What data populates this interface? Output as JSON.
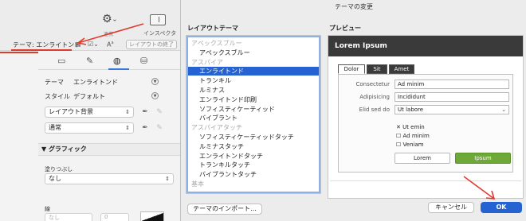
{
  "left_panel": {
    "toolbar": {
      "kanren_label": "連携",
      "inspector_label": "インスペクタ"
    },
    "theme_bar": {
      "theme_label": "テーマ: エンライトンド",
      "layout_button": "レイアウトの終了"
    },
    "properties": {
      "theme_label": "テーマ",
      "theme_value": "エンライトンド",
      "style_label": "スタイル",
      "style_value": "デフォルト",
      "layout_popup": "レイアウト背景",
      "normal_popup": "通常"
    },
    "graphics_section": {
      "header": "▼ グラフィック",
      "fill_label": "塗りつぶし",
      "fill_value": "なし",
      "line_label": "線",
      "line_value": "なし",
      "line_number": "0"
    }
  },
  "dialog": {
    "title": "テーマの変更",
    "layout_theme_heading": "レイアウトテーマ",
    "preview_heading": "プレビュー",
    "theme_list": [
      {
        "label": "アペックスブルー",
        "kind": "group"
      },
      {
        "label": "アペックスブルー",
        "kind": "theme"
      },
      {
        "label": "アスパイア",
        "kind": "group"
      },
      {
        "label": "エンライトンド",
        "kind": "theme",
        "selected": true
      },
      {
        "label": "トランキル",
        "kind": "theme"
      },
      {
        "label": "ルミナス",
        "kind": "theme"
      },
      {
        "label": "エンライトンド印刷",
        "kind": "theme"
      },
      {
        "label": "ソフィスティケーティッド",
        "kind": "theme"
      },
      {
        "label": "バイブラント",
        "kind": "theme"
      },
      {
        "label": "アスパイアタッチ",
        "kind": "group"
      },
      {
        "label": "ソフィスティケーティッドタッチ",
        "kind": "theme"
      },
      {
        "label": "ルミナスタッチ",
        "kind": "theme"
      },
      {
        "label": "エンライトンドタッチ",
        "kind": "theme"
      },
      {
        "label": "トランキルタッチ",
        "kind": "theme"
      },
      {
        "label": "バイブラントタッチ",
        "kind": "theme"
      },
      {
        "label": "基本",
        "kind": "group"
      }
    ],
    "import_button": "テーマのインポート...",
    "preview": {
      "title": "Lorem Ipsum",
      "tabs": [
        "Dolor",
        "Sit",
        "Amet"
      ],
      "fields": [
        {
          "label": "Consectetur",
          "value": "Ad minim"
        },
        {
          "label": "Adipisicing",
          "value": "Incididunt"
        },
        {
          "label": "Elid sed do",
          "value": "Ut labore"
        }
      ],
      "checks": [
        {
          "label": "Ut emin",
          "checked": true
        },
        {
          "label": "Ad minim",
          "checked": false
        },
        {
          "label": "Veniam",
          "checked": false
        }
      ],
      "button_plain": "Lorem",
      "button_green": "Ipsum"
    },
    "cancel_button": "キャンセル",
    "ok_button": "OK"
  },
  "colors": {
    "selection_blue": "#2463d1",
    "annotation_red": "#e03a2f",
    "preview_header": "#3a3a3a",
    "preview_green": "#6ea938"
  }
}
